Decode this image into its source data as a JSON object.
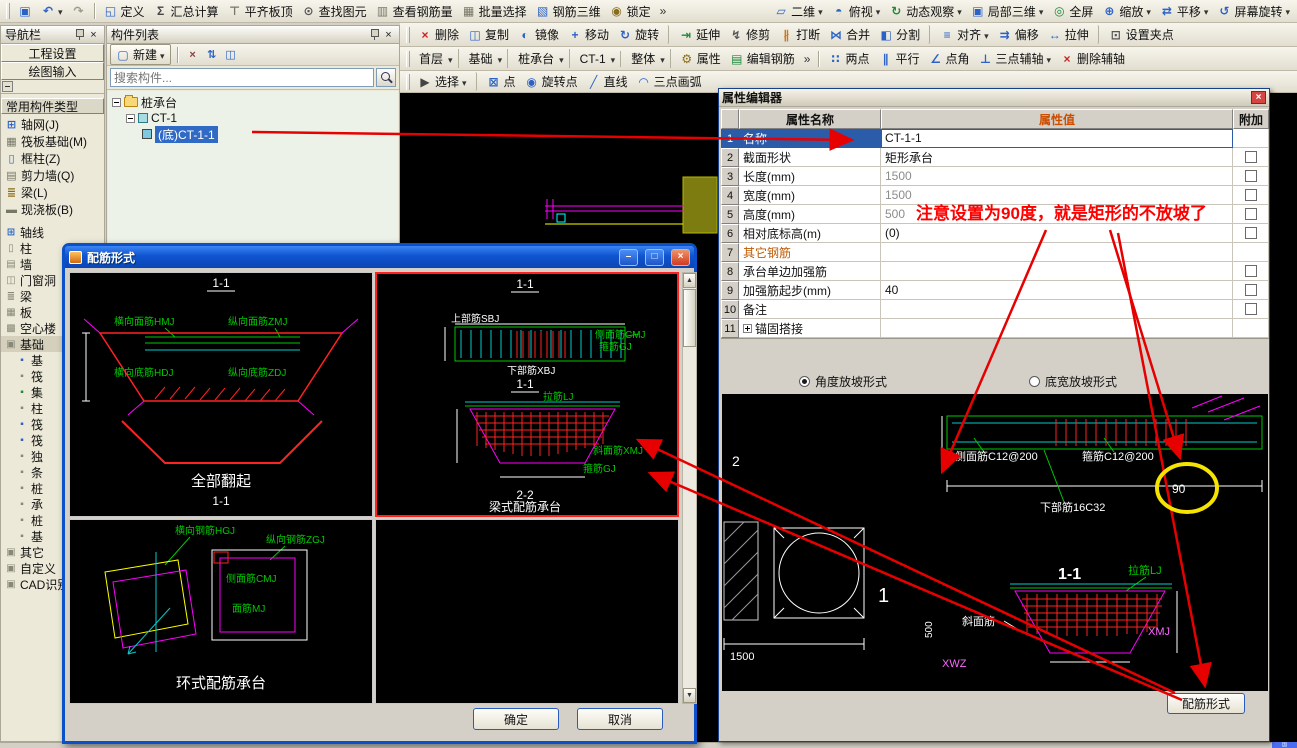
{
  "toolbar1": {
    "left": [
      {
        "name": "save-button",
        "icon": "save-icon",
        "g": "▣",
        "c": "#2a62c8"
      },
      {
        "name": "undo-button",
        "icon": "undo-icon",
        "g": "↶",
        "c": "#2a62c8",
        "dd": true
      },
      {
        "name": "redo-button",
        "icon": "redo-icon",
        "g": "↷",
        "c": "#9a9a8e"
      }
    ],
    "items": [
      {
        "name": "define-button",
        "icon": "define-icon",
        "g": "◱",
        "c": "#2a62c8",
        "label": "定义"
      },
      {
        "name": "summary-calc-button",
        "icon": "summary-calc-icon",
        "g": "Σ",
        "c": "#444444",
        "label": "汇总计算"
      },
      {
        "name": "align-slab-top-button",
        "icon": "align-slab-top-icon",
        "g": "⊤",
        "c": "#777766",
        "label": "平齐板顶"
      },
      {
        "name": "find-element-button",
        "icon": "find-element-icon",
        "g": "⊙",
        "c": "#555555",
        "label": "查找图元"
      },
      {
        "name": "view-rebar-qty-button",
        "icon": "view-rebar-qty-icon",
        "g": "▥",
        "c": "#777766",
        "label": "查看钢筋量"
      },
      {
        "name": "batch-select-button",
        "icon": "batch-select-icon",
        "g": "▦",
        "c": "#777766",
        "label": "批量选择"
      },
      {
        "name": "rebar-3d-button",
        "icon": "rebar-3d-icon",
        "g": "▧",
        "c": "#2a62c8",
        "label": "钢筋三维"
      },
      {
        "name": "lock-button",
        "icon": "lock-icon",
        "g": "◉",
        "c": "#8a6d1a",
        "label": "锁定"
      }
    ],
    "view_items": [
      {
        "name": "view-2d-button",
        "icon": "view-2d-icon",
        "g": "▱",
        "c": "#2a62c8",
        "label": "二维",
        "dd": true
      },
      {
        "name": "top-view-button",
        "icon": "top-view-icon",
        "g": "◓",
        "c": "#2a62c8",
        "label": "俯视",
        "dd": true
      },
      {
        "name": "orbit-button",
        "icon": "orbit-icon",
        "g": "↻",
        "c": "#1f8a3a",
        "label": "动态观察",
        "dd": true
      },
      {
        "name": "local-3d-button",
        "icon": "local-3d-icon",
        "g": "▣",
        "c": "#2a62c8",
        "label": "局部三维",
        "dd": true
      },
      {
        "name": "fullscreen-button",
        "icon": "fullscreen-icon",
        "g": "◎",
        "c": "#1f8a3a",
        "label": "全屏"
      },
      {
        "name": "zoom-button",
        "icon": "zoom-icon",
        "g": "⊕",
        "c": "#2a62c8",
        "label": "缩放",
        "dd": true
      },
      {
        "name": "pan-button",
        "icon": "pan-icon",
        "g": "⇄",
        "c": "#2a62c8",
        "label": "平移",
        "dd": true
      },
      {
        "name": "screen-rotate-button",
        "icon": "screen-rotate-icon",
        "g": "↺",
        "c": "#2a62c8",
        "label": "屏幕旋转",
        "dd": true
      }
    ]
  },
  "toolbar2": {
    "items": [
      {
        "name": "delete-button",
        "icon": "delete-icon",
        "g": "×",
        "c": "#cc2222",
        "label": "删除"
      },
      {
        "name": "copy-button",
        "icon": "copy-icon",
        "g": "◫",
        "c": "#2a62c8",
        "label": "复制"
      },
      {
        "name": "mirror-button",
        "icon": "mirror-icon",
        "g": "◐",
        "c": "#2a62c8",
        "label": "镜像"
      },
      {
        "name": "move-button",
        "icon": "move-icon",
        "g": "+",
        "c": "#2a62c8",
        "label": "移动"
      },
      {
        "name": "rotate-button",
        "icon": "rotate-icon",
        "g": "↻",
        "c": "#2a62c8",
        "label": "旋转",
        "cls": "sepr"
      },
      {
        "name": "extend-button",
        "icon": "extend-icon",
        "g": "⇥",
        "c": "#1f8a3a",
        "label": "延伸"
      },
      {
        "name": "trim-button",
        "icon": "trim-icon",
        "g": "↯",
        "c": "#555555",
        "label": "修剪"
      },
      {
        "name": "break-button",
        "icon": "break-icon",
        "g": "∦",
        "c": "#cc7722",
        "label": "打断"
      },
      {
        "name": "join-button",
        "icon": "join-icon",
        "g": "⋈",
        "c": "#2a62c8",
        "label": "合并"
      },
      {
        "name": "split-button",
        "icon": "split-icon",
        "g": "◧",
        "c": "#2a62c8",
        "label": "分割",
        "cls": "sepr"
      },
      {
        "name": "align-button",
        "icon": "align-icon",
        "g": "≡",
        "c": "#2a62c8",
        "label": "对齐",
        "dd": true
      },
      {
        "name": "offset-button",
        "icon": "offset-icon",
        "g": "⇉",
        "c": "#2a62c8",
        "label": "偏移"
      },
      {
        "name": "stretch-button",
        "icon": "stretch-icon",
        "g": "↔",
        "c": "#2a62c8",
        "label": "拉伸",
        "cls": "sepr"
      },
      {
        "name": "grip-settings-button",
        "icon": "grip-settings-icon",
        "g": "⊡",
        "c": "#555555",
        "label": "设置夹点"
      }
    ]
  },
  "toolbar3": {
    "combos": [
      {
        "name": "floor-combo",
        "label": "首层"
      },
      {
        "name": "category-combo",
        "label": "基础"
      },
      {
        "name": "type-combo",
        "label": "桩承台"
      },
      {
        "name": "element-combo",
        "label": "CT-1"
      },
      {
        "name": "display-mode-combo",
        "label": "整体"
      }
    ],
    "buttons": [
      {
        "name": "properties-button",
        "icon": "properties-icon",
        "g": "⚙",
        "c": "#8a6d1a",
        "label": "属性"
      },
      {
        "name": "edit-rebar-button",
        "icon": "edit-rebar-icon",
        "g": "▤",
        "c": "#1f8a3a",
        "label": "编辑钢筋"
      }
    ],
    "axis_tools": [
      {
        "name": "two-point-button",
        "icon": "two-point-icon",
        "g": "∷",
        "c": "#2a62c8",
        "label": "两点"
      },
      {
        "name": "parallel-button",
        "icon": "parallel-icon",
        "g": "∥",
        "c": "#2a62c8",
        "label": "平行"
      },
      {
        "name": "point-angle-button",
        "icon": "point-angle-icon",
        "g": "∠",
        "c": "#2a62c8",
        "label": "点角"
      },
      {
        "name": "three-point-aux-button",
        "icon": "three-point-aux-icon",
        "g": "⊥",
        "c": "#2a62c8",
        "label": "三点辅轴",
        "dd": true
      },
      {
        "name": "delete-aux-button",
        "icon": "delete-aux-icon",
        "g": "×",
        "c": "#cc2222",
        "label": "删除辅轴"
      }
    ]
  },
  "toolbar4": {
    "items": [
      {
        "name": "select-button",
        "icon": "select-icon",
        "g": "▶",
        "c": "#444444",
        "label": "选择",
        "dd": true,
        "cls": "sepr"
      },
      {
        "name": "point-draw-button",
        "icon": "point-icon",
        "g": "⊠",
        "c": "#2a62c8",
        "label": "点"
      },
      {
        "name": "rotate-point-button",
        "icon": "rotate-point-icon",
        "g": "◉",
        "c": "#2a62c8",
        "label": "旋转点"
      },
      {
        "name": "line-draw-button",
        "icon": "line-icon",
        "g": "╱",
        "c": "#2a62c8",
        "label": "直线"
      },
      {
        "name": "arc3-button",
        "icon": "arc3-icon",
        "g": "◠",
        "c": "#2a62c8",
        "label": "三点画弧"
      }
    ]
  },
  "nav": {
    "title": "导航栏",
    "tabs": [
      {
        "name": "tab-project-settings",
        "label": "工程设置"
      },
      {
        "name": "tab-drawing-input",
        "label": "绘图输入"
      }
    ],
    "section": "常用构件类型",
    "common": [
      {
        "name": "nav-item-axis-net",
        "icon": "axis-net-icon",
        "g": "⊞",
        "c": "#2a62c8",
        "label": "轴网(J)"
      },
      {
        "name": "nav-item-raft-foundation",
        "icon": "raft-foundation-icon",
        "g": "▦",
        "c": "#777766",
        "label": "筏板基础(M)"
      },
      {
        "name": "nav-item-frame-column",
        "icon": "frame-column-icon",
        "g": "▯",
        "c": "#2a62c8",
        "label": "框柱(Z)"
      },
      {
        "name": "nav-item-shear-wall",
        "icon": "shear-wall-icon",
        "g": "▤",
        "c": "#777766",
        "label": "剪力墙(Q)"
      },
      {
        "name": "nav-item-beam",
        "icon": "beam-icon",
        "g": "≣",
        "c": "#8a6d1a",
        "label": "梁(L)"
      },
      {
        "name": "nav-item-slab",
        "icon": "slab-icon",
        "g": "▬",
        "c": "#777766",
        "label": "现浇板(B)"
      }
    ],
    "cats": [
      {
        "name": "cat-axis",
        "icon": "cat-axis-icon",
        "g": "⊞",
        "c": "#2a62c8",
        "label": "轴线"
      },
      {
        "name": "cat-column",
        "icon": "cat-column-icon",
        "g": "▯",
        "c": "#888877",
        "label": "柱"
      },
      {
        "name": "cat-wall",
        "icon": "cat-wall-icon",
        "g": "▤",
        "c": "#888877",
        "label": "墙"
      },
      {
        "name": "cat-opening",
        "icon": "cat-opening-icon",
        "g": "◫",
        "c": "#888877",
        "label": "门窗洞"
      },
      {
        "name": "cat-beam",
        "icon": "cat-beam-icon",
        "g": "≣",
        "c": "#888877",
        "label": "梁"
      },
      {
        "name": "cat-slab",
        "icon": "cat-slab-icon",
        "g": "▦",
        "c": "#888877",
        "label": "板"
      },
      {
        "name": "cat-hollow-slab",
        "icon": "cat-hollow-slab-icon",
        "g": "▩",
        "c": "#888877",
        "label": "空心楼"
      },
      {
        "name": "cat-foundation",
        "icon": "cat-foundation-icon",
        "g": "▣",
        "c": "#888877",
        "label": "基础",
        "cls": "open"
      },
      {
        "name": "cat-sub-1",
        "icon": "sub-item-icon",
        "g": "▪",
        "c": "#2a62c8",
        "label": "基",
        "cls": "sub"
      },
      {
        "name": "cat-sub-2",
        "icon": "sub-item-icon",
        "g": "▪",
        "c": "#888877",
        "label": "筏",
        "cls": "sub"
      },
      {
        "name": "cat-sub-3",
        "icon": "sub-item-icon",
        "g": "▪",
        "c": "#1f8a3a",
        "label": "集",
        "cls": "sub"
      },
      {
        "name": "cat-sub-4",
        "icon": "sub-item-icon",
        "g": "▪",
        "c": "#888877",
        "label": "柱",
        "cls": "sub"
      },
      {
        "name": "cat-sub-5",
        "icon": "sub-item-icon",
        "g": "▪",
        "c": "#2a62c8",
        "label": "筏",
        "cls": "sub"
      },
      {
        "name": "cat-sub-6",
        "icon": "sub-item-icon",
        "g": "▪",
        "c": "#2a62c8",
        "label": "筏",
        "cls": "sub"
      },
      {
        "name": "cat-sub-7",
        "icon": "sub-item-icon",
        "g": "▪",
        "c": "#888877",
        "label": "独",
        "cls": "sub"
      },
      {
        "name": "cat-sub-8",
        "icon": "sub-item-icon",
        "g": "▪",
        "c": "#888877",
        "label": "条",
        "cls": "sub"
      },
      {
        "name": "cat-sub-9",
        "icon": "sub-item-icon",
        "g": "▪",
        "c": "#888877",
        "label": "桩",
        "cls": "sub"
      },
      {
        "name": "cat-sub-10",
        "icon": "sub-item-icon",
        "g": "▪",
        "c": "#888877",
        "label": "承",
        "cls": "sub"
      },
      {
        "name": "cat-sub-11",
        "icon": "sub-item-icon",
        "g": "▪",
        "c": "#888877",
        "label": "桩",
        "cls": "sub"
      },
      {
        "name": "cat-sub-12",
        "icon": "sub-item-icon",
        "g": "▪",
        "c": "#888877",
        "label": "基",
        "cls": "sub"
      },
      {
        "name": "cat-other",
        "icon": "cat-other-icon",
        "g": "▣",
        "c": "#888877",
        "label": "其它"
      },
      {
        "name": "cat-custom",
        "icon": "cat-custom-icon",
        "g": "▣",
        "c": "#888877",
        "label": "自定义"
      },
      {
        "name": "cat-cad-recognition",
        "icon": "cat-cad-icon",
        "g": "▣",
        "c": "#888877",
        "label": "CAD识别"
      }
    ]
  },
  "clist": {
    "title": "构件列表",
    "new_label": "新建",
    "search_placeholder": "搜索构件...",
    "root": "桩承台",
    "group": "CT-1",
    "leaf": "(底)CT-1-1"
  },
  "pe": {
    "title": "属性编辑器",
    "col_name": "属性名称",
    "col_value": "属性值",
    "col_extra": "附加",
    "rows": [
      {
        "num": "1",
        "name": "名称",
        "value": "CT-1-1",
        "cls": "sel"
      },
      {
        "num": "2",
        "name": "截面形状",
        "value": "矩形承台",
        "chk": true
      },
      {
        "num": "3",
        "name": "长度(mm)",
        "value": "1500",
        "chk": true,
        "cls": "dim"
      },
      {
        "num": "4",
        "name": "宽度(mm)",
        "value": "1500",
        "chk": true,
        "cls": "dim"
      },
      {
        "num": "5",
        "name": "高度(mm)",
        "value": "500",
        "chk": true,
        "cls": "dim"
      },
      {
        "num": "6",
        "name": "相对底标高(m)",
        "value": "(0)",
        "chk": true
      },
      {
        "num": "7",
        "name": "其它钢筋",
        "value": "",
        "cls": "orange"
      },
      {
        "num": "8",
        "name": "承台单边加强筋",
        "value": "",
        "chk": true
      },
      {
        "num": "9",
        "name": "加强筋起步(mm)",
        "value": "40",
        "chk": true
      },
      {
        "num": "10",
        "name": "备注",
        "value": "",
        "chk": true
      },
      {
        "num": "11",
        "name": "锚固搭接",
        "value": "",
        "expand": true
      }
    ],
    "radio_angle": "角度放坡形式",
    "radio_width": "底宽放坡形式",
    "btn_rebar": "配筋形式",
    "pv": {
      "side_bar": "侧面筋C12@200",
      "stirrup": "箍筋C12@200",
      "bottom_bar": "下部筋16C32",
      "angle": "90",
      "sec": "1-1",
      "tie": "拉筋LJ",
      "slope": "斜面筋",
      "xmj": "XMJ",
      "xwz": "XWZ",
      "dim1500": "1500",
      "dim500": "500",
      "ax1": "1",
      "ax2": "2"
    }
  },
  "rd": {
    "title": "配筋形式",
    "ok": "确定",
    "cancel": "取消",
    "p1": {
      "sec": "1-1",
      "hmj": "横向面筋HMJ",
      "zmj": "纵向面筋ZMJ",
      "hdj": "横向底筋HDJ",
      "zdj": "纵向底筋ZDJ",
      "caption": "全部翻起",
      "sec2": "1-1"
    },
    "p2": {
      "sec": "1-1",
      "sbj": "上部筋SBJ",
      "cmj": "侧面筋CMJ",
      "gj": "箍筋GJ",
      "xbj": "下部筋XBJ",
      "mid": "1-1",
      "lj": "拉筋LJ",
      "xmj": "斜面筋XMJ",
      "gj2": "箍筋GJ",
      "capnum": "2-2",
      "caption": "梁式配筋承台"
    },
    "p3": {
      "hgj": "横向钢筋HGJ",
      "zgj": "纵向钢筋ZGJ",
      "cmj": "侧面筋CMJ",
      "mj": "面筋MJ",
      "caption": "环式配筋承台"
    }
  },
  "note": {
    "text": "注意设置为90度，就是矩形的不放坡了"
  },
  "status": {
    "ime": "国"
  }
}
